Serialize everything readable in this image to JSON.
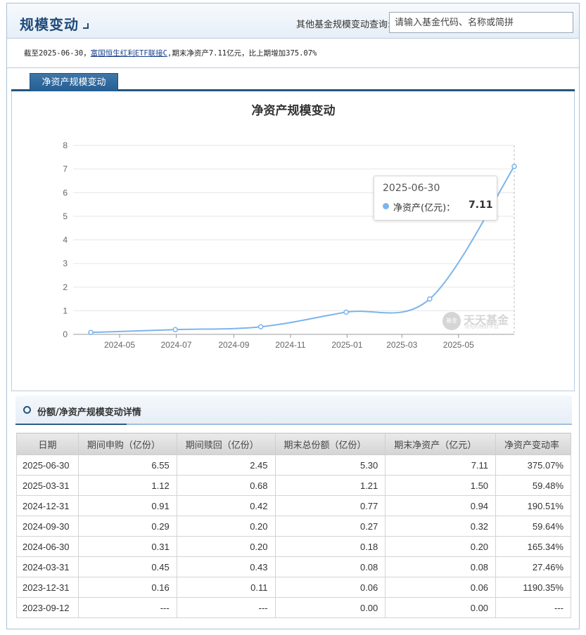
{
  "header": {
    "title": "规模变动",
    "search_label": "其他基金规模变动查询:",
    "search_placeholder": "请输入基金代码、名称或简拼"
  },
  "summary": {
    "prefix": "截至2025-06-30，",
    "fund_link": "富国恒生红利ETF联接C",
    "suffix": ",期末净资产7.11亿元，比上期增加375.07%"
  },
  "tabs": [
    {
      "label": "净资产规模变动"
    }
  ],
  "chart_data": {
    "type": "line",
    "title": "净资产规模变动",
    "series": [
      {
        "name": "净资产(亿元)",
        "x": [
          "2024-03-31",
          "2024-06-30",
          "2024-09-30",
          "2024-12-31",
          "2025-03-31",
          "2025-06-30"
        ],
        "values": [
          0.08,
          0.2,
          0.32,
          0.94,
          1.5,
          7.11
        ]
      }
    ],
    "x_axis_start": "2024-03-12",
    "x_axis_end": "2025-06-30",
    "x_ticks": [
      "2024-05",
      "2024-07",
      "2024-09",
      "2024-11",
      "2025-01",
      "2025-03",
      "2025-05"
    ],
    "ylim": [
      0,
      8
    ],
    "y_ticks": [
      0,
      1,
      2,
      3,
      4,
      5,
      6,
      7,
      8
    ],
    "grid": true,
    "color": "#7cb5ec",
    "tooltip": {
      "date": "2025-06-30",
      "label": "净资产(亿元)：",
      "value": "7.11"
    },
    "watermark": {
      "text": "天天基金",
      "sub": "领先的理财平台",
      "badge": "基金"
    }
  },
  "detail": {
    "title": "份额/净资产规模变动详情",
    "columns": [
      "日期",
      "期间申购（亿份）",
      "期间赎回（亿份）",
      "期末总份额（亿份）",
      "期末净资产（亿元）",
      "净资产变动率"
    ],
    "rows": [
      [
        "2025-06-30",
        "6.55",
        "2.45",
        "5.30",
        "7.11",
        "375.07%"
      ],
      [
        "2025-03-31",
        "1.12",
        "0.68",
        "1.21",
        "1.50",
        "59.48%"
      ],
      [
        "2024-12-31",
        "0.91",
        "0.42",
        "0.77",
        "0.94",
        "190.51%"
      ],
      [
        "2024-09-30",
        "0.29",
        "0.20",
        "0.27",
        "0.32",
        "59.64%"
      ],
      [
        "2024-06-30",
        "0.31",
        "0.20",
        "0.18",
        "0.20",
        "165.34%"
      ],
      [
        "2024-03-31",
        "0.45",
        "0.43",
        "0.08",
        "0.08",
        "27.46%"
      ],
      [
        "2023-12-31",
        "0.16",
        "0.11",
        "0.06",
        "0.06",
        "1190.35%"
      ],
      [
        "2023-09-12",
        "---",
        "---",
        "0.00",
        "0.00",
        "---"
      ]
    ]
  }
}
